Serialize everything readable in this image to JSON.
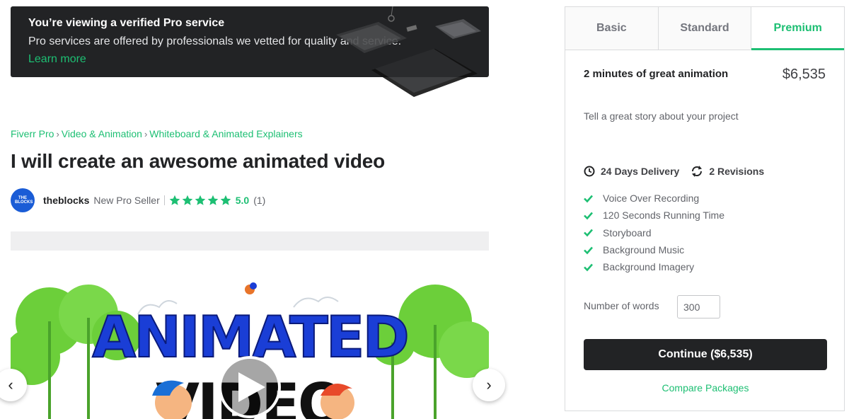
{
  "banner": {
    "title": "You’re viewing a verified Pro service",
    "text": "Pro services are offered by professionals we vetted for quality and service.",
    "link": "Learn more"
  },
  "breadcrumb": [
    "Fiverr Pro",
    "Video & Animation",
    "Whiteboard & Animated Explainers"
  ],
  "gig": {
    "title": "I will create an awesome animated video"
  },
  "seller": {
    "avatar_text": "THE BLOCKS",
    "name": "theblocks",
    "level": "New Pro Seller",
    "rating": "5.0",
    "review_count": "(1)",
    "stars": 5
  },
  "gallery": {
    "line1": "ANIMATED",
    "line2": "VIDEO",
    "prev_icon": "chevron-left-icon",
    "next_icon": "chevron-right-icon"
  },
  "package": {
    "tabs": [
      "Basic",
      "Standard",
      "Premium"
    ],
    "active_tab": "Premium",
    "heading": "2 minutes of great animation",
    "price": "$6,535",
    "description": "Tell a great story about your project",
    "delivery": "24 Days Delivery",
    "revisions": "2 Revisions",
    "features": [
      "Voice Over Recording",
      "120 Seconds Running Time",
      "Storyboard",
      "Background Music",
      "Background Imagery"
    ],
    "words_label": "Number of words",
    "words_value": "300",
    "continue_label": "Continue ($6,535)",
    "compare_label": "Compare Packages"
  },
  "colors": {
    "accent": "#1dbf73",
    "dark": "#222325",
    "animated_blue": "#1a3ed6",
    "tree_green": "#6ccf3a"
  }
}
